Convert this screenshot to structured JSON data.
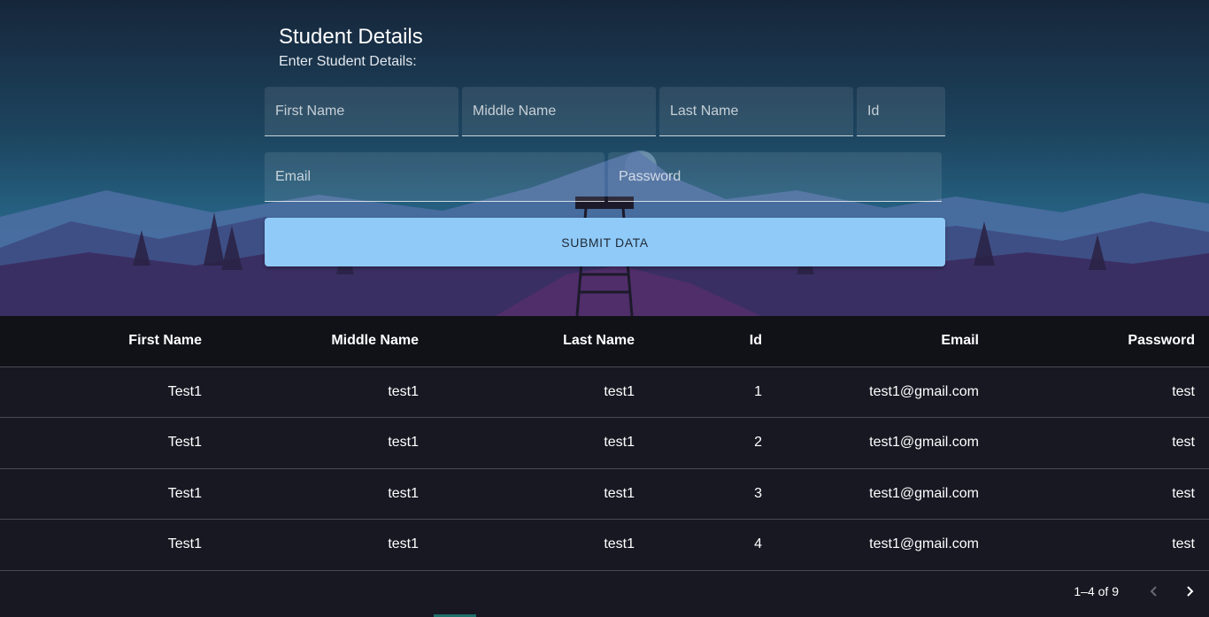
{
  "form": {
    "title": "Student Details",
    "subtitle": "Enter Student Details:",
    "fields": {
      "first_name": {
        "placeholder": "First Name",
        "value": ""
      },
      "middle_name": {
        "placeholder": "Middle Name",
        "value": ""
      },
      "last_name": {
        "placeholder": "Last Name",
        "value": ""
      },
      "id": {
        "placeholder": "Id",
        "value": ""
      },
      "email": {
        "placeholder": "Email",
        "value": ""
      },
      "password": {
        "placeholder": "Password",
        "value": ""
      }
    },
    "submit_label": "SUBMIT DATA"
  },
  "table": {
    "columns": [
      "First Name",
      "Middle Name",
      "Last Name",
      "Id",
      "Email",
      "Password"
    ],
    "rows": [
      [
        "Test1",
        "test1",
        "test1",
        "1",
        "test1@gmail.com",
        "test"
      ],
      [
        "Test1",
        "test1",
        "test1",
        "2",
        "test1@gmail.com",
        "test"
      ],
      [
        "Test1",
        "test1",
        "test1",
        "3",
        "test1@gmail.com",
        "test"
      ],
      [
        "Test1",
        "test1",
        "test1",
        "4",
        "test1@gmail.com",
        "test"
      ]
    ]
  },
  "pagination": {
    "label": "1–4 of 9",
    "prev_icon": "chevron-left-icon",
    "next_icon": "chevron-right-icon"
  },
  "colors": {
    "accent": "#90caf9",
    "table_bg": "#16181f"
  }
}
